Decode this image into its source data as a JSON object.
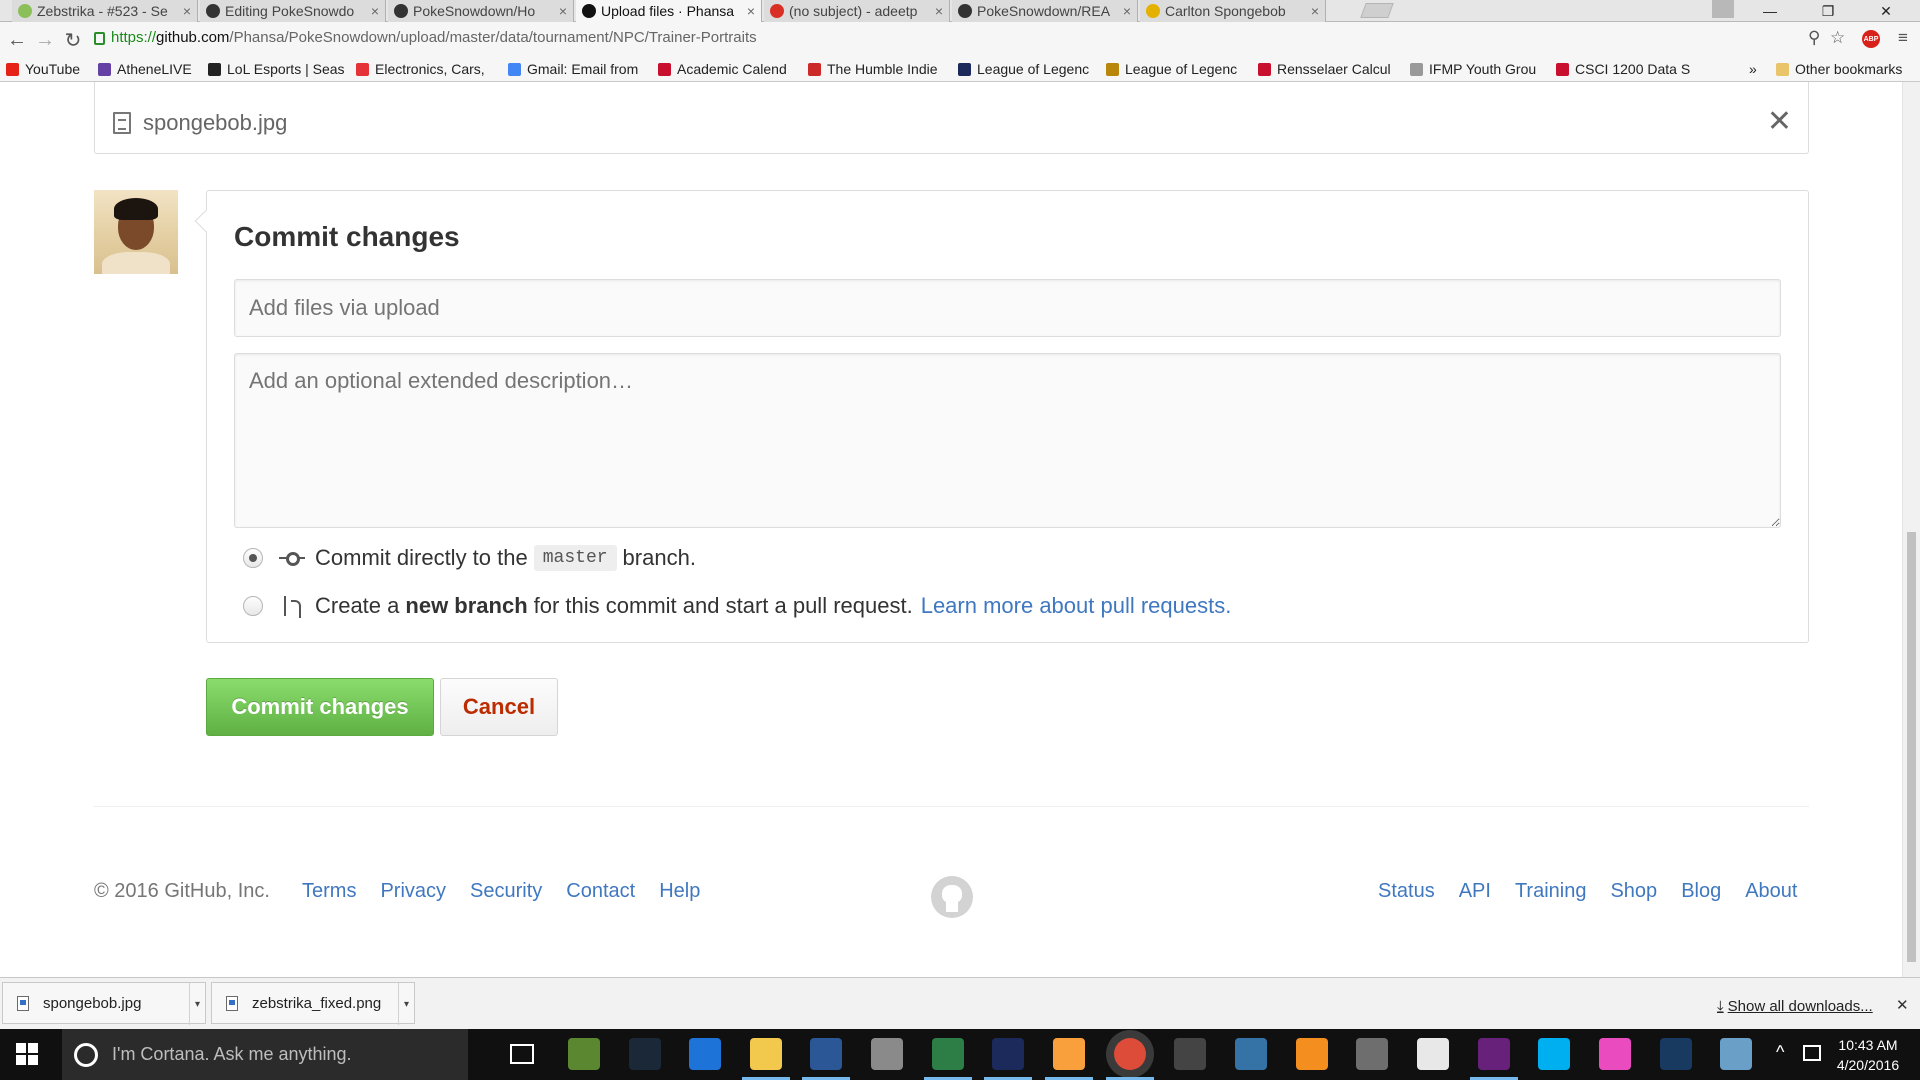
{
  "browser": {
    "tabs": [
      {
        "title": "Zebstrika - #523 - Se",
        "icon_color": "#8bbf5a",
        "active": false
      },
      {
        "title": "Editing PokeSnowdo",
        "icon_color": "#333333",
        "active": false
      },
      {
        "title": "PokeSnowdown/Ho",
        "icon_color": "#333333",
        "active": false
      },
      {
        "title": "Upload files · Phansa",
        "icon_color": "#111111",
        "active": true
      },
      {
        "title": "(no subject) - adeetp",
        "icon_color": "#d93025",
        "active": false
      },
      {
        "title": "PokeSnowdown/REA",
        "icon_color": "#333333",
        "active": false
      },
      {
        "title": "Carlton Spongebob",
        "icon_color": "#e5b100",
        "active": false
      }
    ],
    "window_controls": {
      "minimize": "—",
      "restore": "❐",
      "close": "✕"
    },
    "url": {
      "protocol": "https://",
      "host": "github.com",
      "path": "/Phansa/PokeSnowdown/upload/master/data/tournament/NPC/Trainer-Portraits"
    },
    "toolbar_icons": {
      "back": "←",
      "forward": "→",
      "reload": "↻",
      "zoom": "⚲",
      "star": "☆",
      "abp": "ABP",
      "menu": "≡"
    },
    "bookmarks": [
      {
        "label": "YouTube",
        "color": "#e62117"
      },
      {
        "label": "AtheneLIVE",
        "color": "#6441a5"
      },
      {
        "label": "LoL Esports | Seas",
        "color": "#222222"
      },
      {
        "label": "Electronics, Cars,",
        "color": "#e53238"
      },
      {
        "label": "Gmail: Email from",
        "color": "#4285f4"
      },
      {
        "label": "Academic Calend",
        "color": "#c8102e"
      },
      {
        "label": "The Humble Indie",
        "color": "#cc2929"
      },
      {
        "label": "League of Legenc",
        "color": "#1b2a5b"
      },
      {
        "label": "League of Legenc",
        "color": "#b8860b"
      },
      {
        "label": "Rensselaer Calcul",
        "color": "#c8102e"
      },
      {
        "label": "IFMP Youth Grou",
        "color": "#999999"
      },
      {
        "label": "CSCI 1200 Data S",
        "color": "#c8102e"
      }
    ],
    "bookmarks_overflow": "»",
    "other_bookmarks": "Other bookmarks"
  },
  "file": {
    "name": "spongebob.jpg",
    "remove_glyph": "✕"
  },
  "commit": {
    "title": "Commit changes",
    "summary_placeholder": "Add files via upload",
    "description_placeholder": "Add an optional extended description…",
    "option_direct": {
      "prefix": "Commit directly to the",
      "branch": "master",
      "suffix": "branch.",
      "checked": true
    },
    "option_new": {
      "prefix": "Create a",
      "strong": "new branch",
      "middle": "for this commit and start a pull request.",
      "link": "Learn more about pull requests.",
      "checked": false
    },
    "submit_label": "Commit changes",
    "cancel_label": "Cancel"
  },
  "footer": {
    "copyright": "© 2016 GitHub, Inc.",
    "left_links": [
      "Terms",
      "Privacy",
      "Security",
      "Contact",
      "Help"
    ],
    "right_links": [
      "Status",
      "API",
      "Training",
      "Shop",
      "Blog",
      "About"
    ]
  },
  "downloads": {
    "items": [
      "spongebob.jpg",
      "zebstrika_fixed.png"
    ],
    "show_all": "Show all downloads...",
    "close_glyph": "✕"
  },
  "taskbar": {
    "cortana_placeholder": "I'm Cortana. Ask me anything.",
    "apps": [
      {
        "name": "minecraft",
        "color": "#5b8731"
      },
      {
        "name": "steam",
        "color": "#1b2838"
      },
      {
        "name": "edge",
        "color": "#1e73d8"
      },
      {
        "name": "file-explorer",
        "color": "#f2c94c"
      },
      {
        "name": "word",
        "color": "#2b5797"
      },
      {
        "name": "settings-app",
        "color": "#8a8a8a"
      },
      {
        "name": "terminal",
        "color": "#2d7d46"
      },
      {
        "name": "league-client",
        "color": "#1b2a5b"
      },
      {
        "name": "sublime",
        "color": "#f9a03c"
      },
      {
        "name": "chrome",
        "color": "#dd4b39"
      },
      {
        "name": "obs",
        "color": "#444444"
      },
      {
        "name": "python",
        "color": "#3572a5"
      },
      {
        "name": "fl-studio",
        "color": "#f48f1f"
      },
      {
        "name": "teamspeak",
        "color": "#6e6e6e"
      },
      {
        "name": "rstudio",
        "color": "#e8e8e8"
      },
      {
        "name": "visual-studio",
        "color": "#68217a"
      },
      {
        "name": "skype",
        "color": "#00aff0"
      },
      {
        "name": "itunes",
        "color": "#ea4cc0"
      },
      {
        "name": "virtualbox",
        "color": "#183a61"
      },
      {
        "name": "unknown-app",
        "color": "#6aa0c8"
      }
    ],
    "time": "10:43 AM",
    "date": "4/20/2016"
  }
}
